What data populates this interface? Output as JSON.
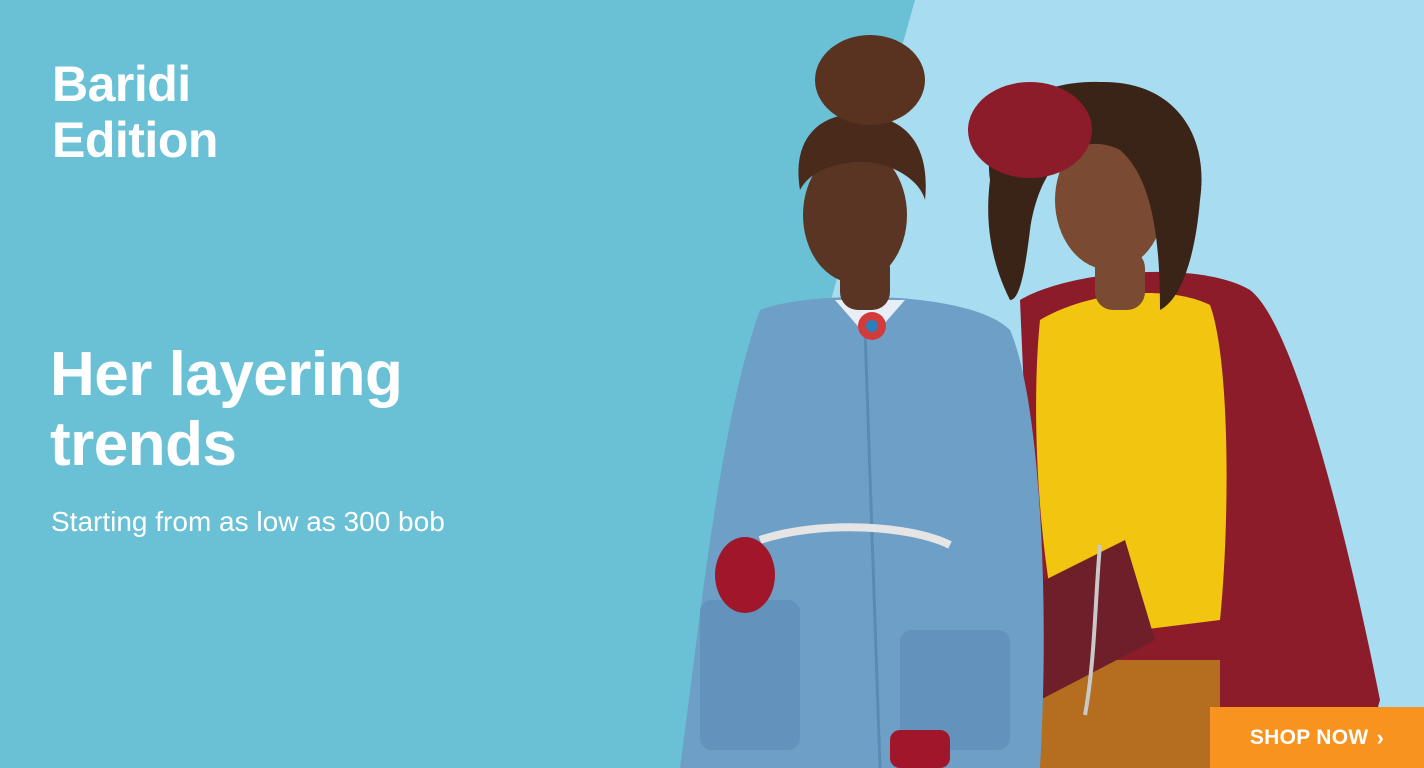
{
  "banner": {
    "brand_line1": "Baridi",
    "brand_line2": "Edition",
    "headline_line1": "Her layering",
    "headline_line2": "trends",
    "subline": "Starting from as low as 300 bob",
    "cta_label": "SHOP NOW",
    "cta_icon": "chevron-right-icon"
  },
  "colors": {
    "background_left": "#6ac1d6",
    "background_right": "#a8dcf0",
    "cta_background": "#f7931e",
    "text": "#ffffff"
  }
}
